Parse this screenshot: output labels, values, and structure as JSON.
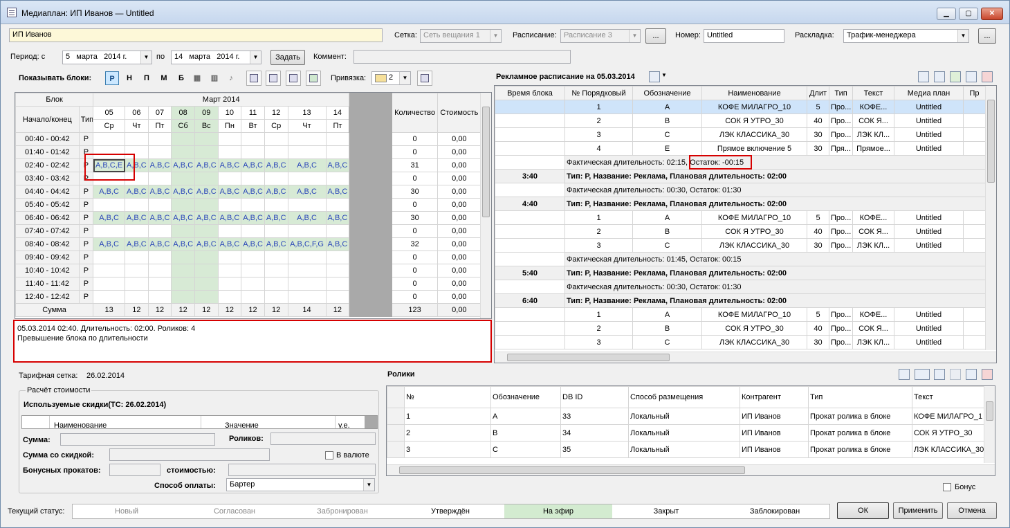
{
  "window": {
    "title": "Медиаплан: ИП Иванов — Untitled"
  },
  "header": {
    "client": "ИП Иванов",
    "grid_label": "Сетка:",
    "grid_value": "Сеть вещания 1",
    "schedule_label": "Расписание:",
    "schedule_value": "Расписание 3",
    "ellipsis": "...",
    "number_label": "Номер:",
    "number_value": "Untitled",
    "layout_label": "Раскладка:",
    "layout_value": "Трафик-менеджера",
    "period_label": "Период: с",
    "date_from_day": "5",
    "date_from_month": "марта",
    "date_from_year": "2014 г.",
    "to_label": "по",
    "date_to_day": "14",
    "date_to_month": "марта",
    "date_to_year": "2014 г.",
    "set_button": "Задать",
    "comment_label": "Коммент:",
    "comment_value": ""
  },
  "toolbar": {
    "show_blocks_label": "Показывать блоки:",
    "toggles": [
      "Р",
      "Н",
      "П",
      "М",
      "Б"
    ],
    "binding_label": "Привязка:",
    "binding_value": "2"
  },
  "schedule": {
    "col_block": "Блок",
    "col_time": "Начало/конец",
    "col_type": "Тип",
    "month": "Март 2014",
    "days": [
      {
        "d": "05",
        "w": "Ср"
      },
      {
        "d": "06",
        "w": "Чт"
      },
      {
        "d": "07",
        "w": "Пт"
      },
      {
        "d": "08",
        "w": "Сб"
      },
      {
        "d": "09",
        "w": "Вс"
      },
      {
        "d": "10",
        "w": "Пн"
      },
      {
        "d": "11",
        "w": "Вт"
      },
      {
        "d": "12",
        "w": "Ср"
      },
      {
        "d": "13",
        "w": "Чт"
      },
      {
        "d": "14",
        "w": "Пт"
      }
    ],
    "col_qty": "Количество",
    "col_cost": "Стоимость",
    "rows": [
      {
        "t": "00:40 - 00:42",
        "type": "Р",
        "cells": [
          "",
          "",
          "",
          "",
          "",
          "",
          "",
          "",
          "",
          ""
        ],
        "qty": "0",
        "cost": "0,00"
      },
      {
        "t": "01:40 - 01:42",
        "type": "Р",
        "cells": [
          "",
          "",
          "",
          "",
          "",
          "",
          "",
          "",
          "",
          ""
        ],
        "qty": "0",
        "cost": "0,00"
      },
      {
        "t": "02:40 - 02:42",
        "type": "Р",
        "cells": [
          "A,B,C,E",
          "A,B,C",
          "A,B,C",
          "A,B,C",
          "A,B,C",
          "A,B,C",
          "A,B,C",
          "A,B,C",
          "A,B,C",
          "A,B,C"
        ],
        "qty": "31",
        "cost": "0,00"
      },
      {
        "t": "03:40 - 03:42",
        "type": "Р",
        "cells": [
          "",
          "",
          "",
          "",
          "",
          "",
          "",
          "",
          "",
          ""
        ],
        "qty": "0",
        "cost": "0,00"
      },
      {
        "t": "04:40 - 04:42",
        "type": "Р",
        "cells": [
          "A,B,C",
          "A,B,C",
          "A,B,C",
          "A,B,C",
          "A,B,C",
          "A,B,C",
          "A,B,C",
          "A,B,C",
          "A,B,C",
          "A,B,C"
        ],
        "qty": "30",
        "cost": "0,00"
      },
      {
        "t": "05:40 - 05:42",
        "type": "Р",
        "cells": [
          "",
          "",
          "",
          "",
          "",
          "",
          "",
          "",
          "",
          ""
        ],
        "qty": "0",
        "cost": "0,00"
      },
      {
        "t": "06:40 - 06:42",
        "type": "Р",
        "cells": [
          "A,B,C",
          "A,B,C",
          "A,B,C",
          "A,B,C",
          "A,B,C",
          "A,B,C",
          "A,B,C",
          "A,B,C",
          "A,B,C",
          "A,B,C"
        ],
        "qty": "30",
        "cost": "0,00"
      },
      {
        "t": "07:40 - 07:42",
        "type": "Р",
        "cells": [
          "",
          "",
          "",
          "",
          "",
          "",
          "",
          "",
          "",
          ""
        ],
        "qty": "0",
        "cost": "0,00"
      },
      {
        "t": "08:40 - 08:42",
        "type": "Р",
        "cells": [
          "A,B,C",
          "A,B,C",
          "A,B,C",
          "A,B,C",
          "A,B,C",
          "A,B,C",
          "A,B,C",
          "A,B,C",
          "A,B,C,F,G",
          "A,B,C"
        ],
        "qty": "32",
        "cost": "0,00"
      },
      {
        "t": "09:40 - 09:42",
        "type": "Р",
        "cells": [
          "",
          "",
          "",
          "",
          "",
          "",
          "",
          "",
          "",
          ""
        ],
        "qty": "0",
        "cost": "0,00"
      },
      {
        "t": "10:40 - 10:42",
        "type": "Р",
        "cells": [
          "",
          "",
          "",
          "",
          "",
          "",
          "",
          "",
          "",
          ""
        ],
        "qty": "0",
        "cost": "0,00"
      },
      {
        "t": "11:40 - 11:42",
        "type": "Р",
        "cells": [
          "",
          "",
          "",
          "",
          "",
          "",
          "",
          "",
          "",
          ""
        ],
        "qty": "0",
        "cost": "0,00"
      },
      {
        "t": "12:40 - 12:42",
        "type": "Р",
        "cells": [
          "",
          "",
          "",
          "",
          "",
          "",
          "",
          "",
          "",
          ""
        ],
        "qty": "0",
        "cost": "0,00"
      }
    ],
    "sum_label": "Сумма",
    "sums": [
      "13",
      "12",
      "12",
      "12",
      "12",
      "12",
      "12",
      "12",
      "14",
      "12"
    ],
    "sum_qty": "123",
    "sum_cost": "0,00"
  },
  "info_box": {
    "line1": "05.03.2014 02:40. Длительность: 02:00. Роликов: 4",
    "line2": "Превышение блока по длительности"
  },
  "ad_schedule": {
    "title": "Рекламное расписание на 05.03.2014",
    "columns": [
      "Время блока",
      "№ Порядковый",
      "Обозначение",
      "Наименование",
      "Длит",
      "Тип",
      "Текст",
      "Медиа план",
      "Пр"
    ],
    "rows": [
      {
        "k": "item",
        "sel": true,
        "n": "1",
        "code": "A",
        "name": "КОФЕ МИЛАГРО_10",
        "dur": "5",
        "type": "Про...",
        "text": "КОФЕ...",
        "plan": "Untitled"
      },
      {
        "k": "item",
        "n": "2",
        "code": "B",
        "name": "СОК Я УТРО_30",
        "dur": "40",
        "type": "Про...",
        "text": "СОК Я...",
        "plan": "Untitled"
      },
      {
        "k": "item",
        "n": "3",
        "code": "C",
        "name": "ЛЭК КЛАССИКА_30",
        "dur": "30",
        "type": "Про...",
        "text": "ЛЭК КЛ...",
        "plan": "Untitled"
      },
      {
        "k": "item",
        "n": "4",
        "code": "E",
        "name": "Прямое включение 5",
        "dur": "30",
        "type": "Пря...",
        "text": "Прямое...",
        "plan": "Untitled"
      },
      {
        "k": "fact",
        "a": "Фактическая длительность: 02:15,",
        "b": " Остаток: -00:15"
      },
      {
        "k": "group",
        "time": "3:40",
        "text": "Тип: Р, Название: Реклама, Плановая длительность: 02:00"
      },
      {
        "k": "fact",
        "a": "Фактическая длительность: 00:30, Остаток: 01:30",
        "b": ""
      },
      {
        "k": "group",
        "time": "4:40",
        "text": "Тип: Р, Название: Реклама, Плановая длительность: 02:00"
      },
      {
        "k": "item",
        "n": "1",
        "code": "A",
        "name": "КОФЕ МИЛАГРО_10",
        "dur": "5",
        "type": "Про...",
        "text": "КОФЕ...",
        "plan": "Untitled"
      },
      {
        "k": "item",
        "n": "2",
        "code": "B",
        "name": "СОК Я УТРО_30",
        "dur": "40",
        "type": "Про...",
        "text": "СОК Я...",
        "plan": "Untitled"
      },
      {
        "k": "item",
        "n": "3",
        "code": "C",
        "name": "ЛЭК КЛАССИКА_30",
        "dur": "30",
        "type": "Про...",
        "text": "ЛЭК КЛ...",
        "plan": "Untitled"
      },
      {
        "k": "fact",
        "a": "Фактическая длительность: 01:45, Остаток: 00:15",
        "b": ""
      },
      {
        "k": "group",
        "time": "5:40",
        "text": "Тип: Р, Название: Реклама, Плановая длительность: 02:00"
      },
      {
        "k": "fact",
        "a": "Фактическая длительность: 00:30, Остаток: 01:30",
        "b": ""
      },
      {
        "k": "group",
        "time": "6:40",
        "text": "Тип: Р, Название: Реклама, Плановая длительность: 02:00"
      },
      {
        "k": "item",
        "n": "1",
        "code": "A",
        "name": "КОФЕ МИЛАГРО_10",
        "dur": "5",
        "type": "Про...",
        "text": "КОФЕ...",
        "plan": "Untitled"
      },
      {
        "k": "item",
        "n": "2",
        "code": "B",
        "name": "СОК Я УТРО_30",
        "dur": "40",
        "type": "Про...",
        "text": "СОК Я...",
        "plan": "Untitled"
      },
      {
        "k": "item",
        "n": "3",
        "code": "C",
        "name": "ЛЭК КЛАССИКА_30",
        "dur": "30",
        "type": "Про...",
        "text": "ЛЭК КЛ...",
        "plan": "Untitled"
      }
    ]
  },
  "tariff": {
    "label": "Тарифная сетка:",
    "value": "26.02.2014"
  },
  "calc": {
    "group_title": "Расчёт стоимости",
    "discounts_title": "Используемые скидки(ТС: 26.02.2014)",
    "col_name": "Наименование",
    "col_value": "Значение",
    "col_unit": "у.е.",
    "sum_label": "Сумма:",
    "spots_label": "Роликов:",
    "sum_disc_label": "Сумма со скидкой:",
    "currency_label": "В валюте",
    "bonus_label": "Бонусных прокатов:",
    "cost_label": "стоимостью:",
    "payment_label": "Способ оплаты:",
    "payment_value": "Бартер"
  },
  "spots": {
    "title": "Ролики",
    "columns": [
      "№",
      "Обозначение",
      "DB ID",
      "Способ размещения",
      "Контрагент",
      "Тип",
      "Текст"
    ],
    "rows": [
      [
        "1",
        "A",
        "33",
        "Локальный",
        "ИП Иванов",
        "Прокат ролика в блоке",
        "КОФЕ МИЛАГРО_1"
      ],
      [
        "2",
        "B",
        "34",
        "Локальный",
        "ИП Иванов",
        "Прокат ролика в блоке",
        "СОК Я УТРО_30"
      ],
      [
        "3",
        "C",
        "35",
        "Локальный",
        "ИП Иванов",
        "Прокат ролика в блоке",
        "ЛЭК КЛАССИКА_30"
      ]
    ],
    "bonus_label": "Бонус"
  },
  "status": {
    "label": "Текущий статус:",
    "steps": [
      "Новый",
      "Согласован",
      "Забронирован",
      "Утверждён",
      "На эфир",
      "Закрыт",
      "Заблокирован"
    ],
    "active": "На эфир",
    "active_color": "#d3ebd0"
  },
  "buttons": {
    "ok": "ОК",
    "apply": "Применить",
    "cancel": "Отмена"
  }
}
